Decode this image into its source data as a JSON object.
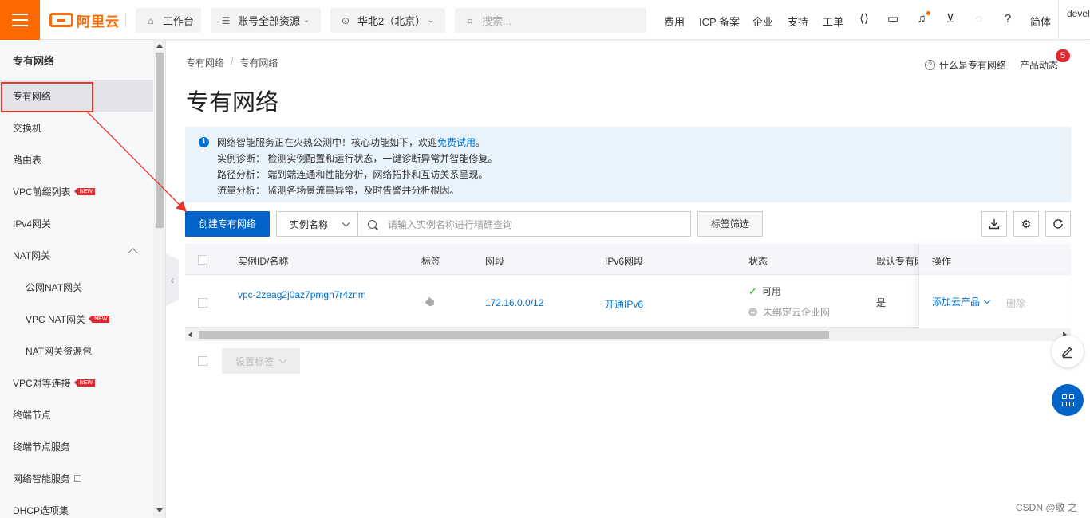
{
  "topbar": {
    "logo_text": "阿里云",
    "workbench": "工作台",
    "account_scope": "账号全部资源",
    "region": "华北2（北京）",
    "search_placeholder": "搜索...",
    "links": [
      "费用",
      "ICP 备案",
      "企业",
      "支持",
      "工单"
    ],
    "language": "简体",
    "user": "devel",
    "icons": [
      "hamburger-icon",
      "home-icon",
      "resource-group-icon",
      "location-pin-icon",
      "search-icon",
      "code-icon",
      "terminal-icon",
      "bell-icon",
      "cart-icon",
      "lightbulb-icon",
      "help-icon"
    ]
  },
  "sidebar": {
    "title": "专有网络",
    "items": [
      {
        "label": "专有网络",
        "active": true
      },
      {
        "label": "交换机"
      },
      {
        "label": "路由表"
      },
      {
        "label": "VPC前缀列表",
        "badge": "NEW"
      },
      {
        "label": "IPv4网关"
      },
      {
        "label": "NAT网关",
        "expanded": true
      },
      {
        "label": "公网NAT网关",
        "sub": true
      },
      {
        "label": "VPC NAT网关",
        "sub": true,
        "badge": "NEW"
      },
      {
        "label": "NAT网关资源包",
        "sub": true
      },
      {
        "label": "VPC对等连接",
        "badge": "NEW"
      },
      {
        "label": "终端节点"
      },
      {
        "label": "终端节点服务"
      },
      {
        "label": "网络智能服务",
        "external": true
      },
      {
        "label": "DHCP选项集"
      }
    ]
  },
  "main": {
    "breadcrumb": [
      "专有网络",
      "专有网络"
    ],
    "breadcrumb_sep": "/",
    "help_link": "什么是专有网络",
    "product_news": "产品动态",
    "news_count": "5",
    "page_title": "专有网络",
    "notice": {
      "line1_prefix": "网络智能服务正在火热公测中！核心功能如下，欢迎",
      "line1_link": "免费试用",
      "line1_suffix": "。",
      "line2": "实例诊断：  检测实例配置和运行状态，一键诊断异常并智能修复。",
      "line3": "路径分析：  端到端连通和性能分析，网络拓扑和互访关系呈现。",
      "line4": "流量分析：  监测各场景流量异常，及时告警并分析根因。"
    },
    "create_button": "创建专有网络",
    "filter_field": "实例名称",
    "filter_placeholder": "请输入实例名称进行精确查询",
    "tag_filter_button": "标签筛选",
    "table": {
      "columns": [
        "实例ID/名称",
        "标签",
        "网段",
        "IPv6网段",
        "状态",
        "默认专有网",
        "操作"
      ],
      "rows": [
        {
          "id": "vpc-2zeag2j0az7pmgn7r4znm",
          "cidr": "172.16.0.0/12",
          "ipv6": "开通IPv6",
          "status": "可用",
          "cen_status": "未绑定云企业网",
          "default": "是",
          "action_add": "添加云产品",
          "action_delete": "删除"
        }
      ]
    },
    "set_tags_button": "设置标签",
    "watermark": "CSDN @敬 之"
  },
  "colors": {
    "brand_orange": "#ff6a00",
    "primary_blue": "#0064c8",
    "link_blue": "#0070cc",
    "annotation_red": "#e8342e"
  }
}
